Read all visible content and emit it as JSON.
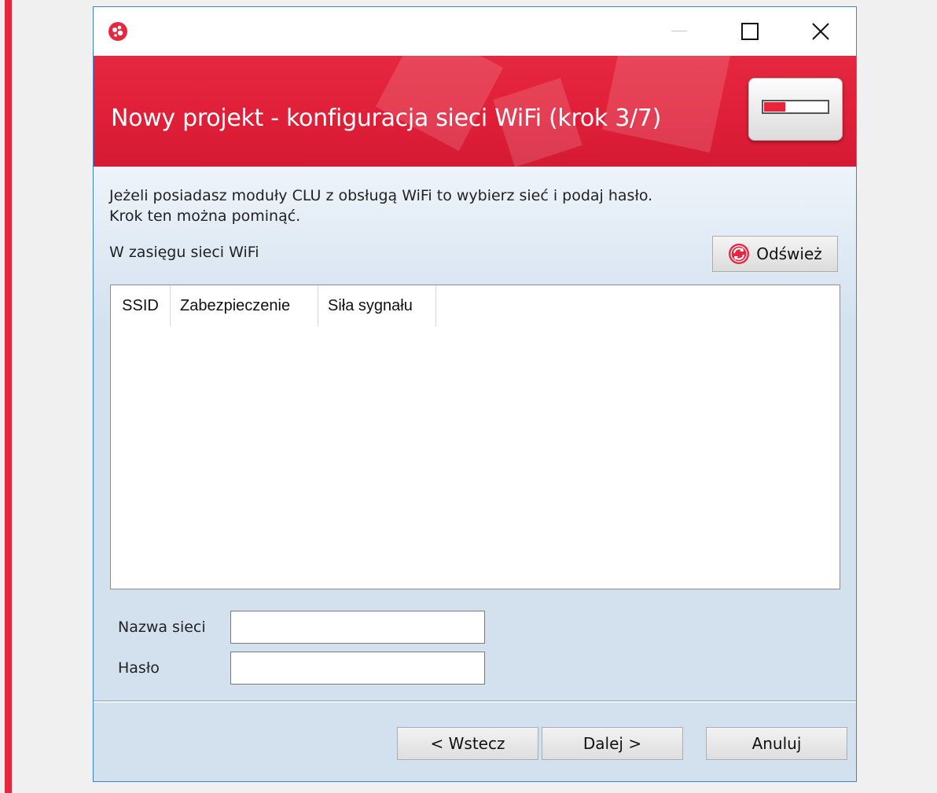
{
  "window": {
    "title": "Nowy projekt - konfiguracja sieci WiFi (krok 3/7)",
    "step_progress": 0.34,
    "accent_color": "#e5283f"
  },
  "content": {
    "instruction_line1": "Jeżeli posiadasz moduły CLU z obsługą WiFi to wybierz sieć i podaj hasło.",
    "instruction_line2": "Krok ten można pominąć.",
    "wifi_section_label": "W zasięgu sieci WiFi",
    "refresh_label": "Odśwież",
    "table_columns": [
      "SSID",
      "Zabezpieczenie",
      "Siła sygnału"
    ],
    "table_rows": [],
    "network_name_label": "Nazwa sieci",
    "network_name_value": "",
    "password_label": "Hasło",
    "password_value": ""
  },
  "footer": {
    "back_label": "< Wstecz",
    "next_label": "Dalej >",
    "cancel_label": "Anuluj"
  },
  "icons": [
    "app-logo-icon",
    "minimize-icon",
    "maximize-icon",
    "close-icon",
    "refresh-icon"
  ]
}
